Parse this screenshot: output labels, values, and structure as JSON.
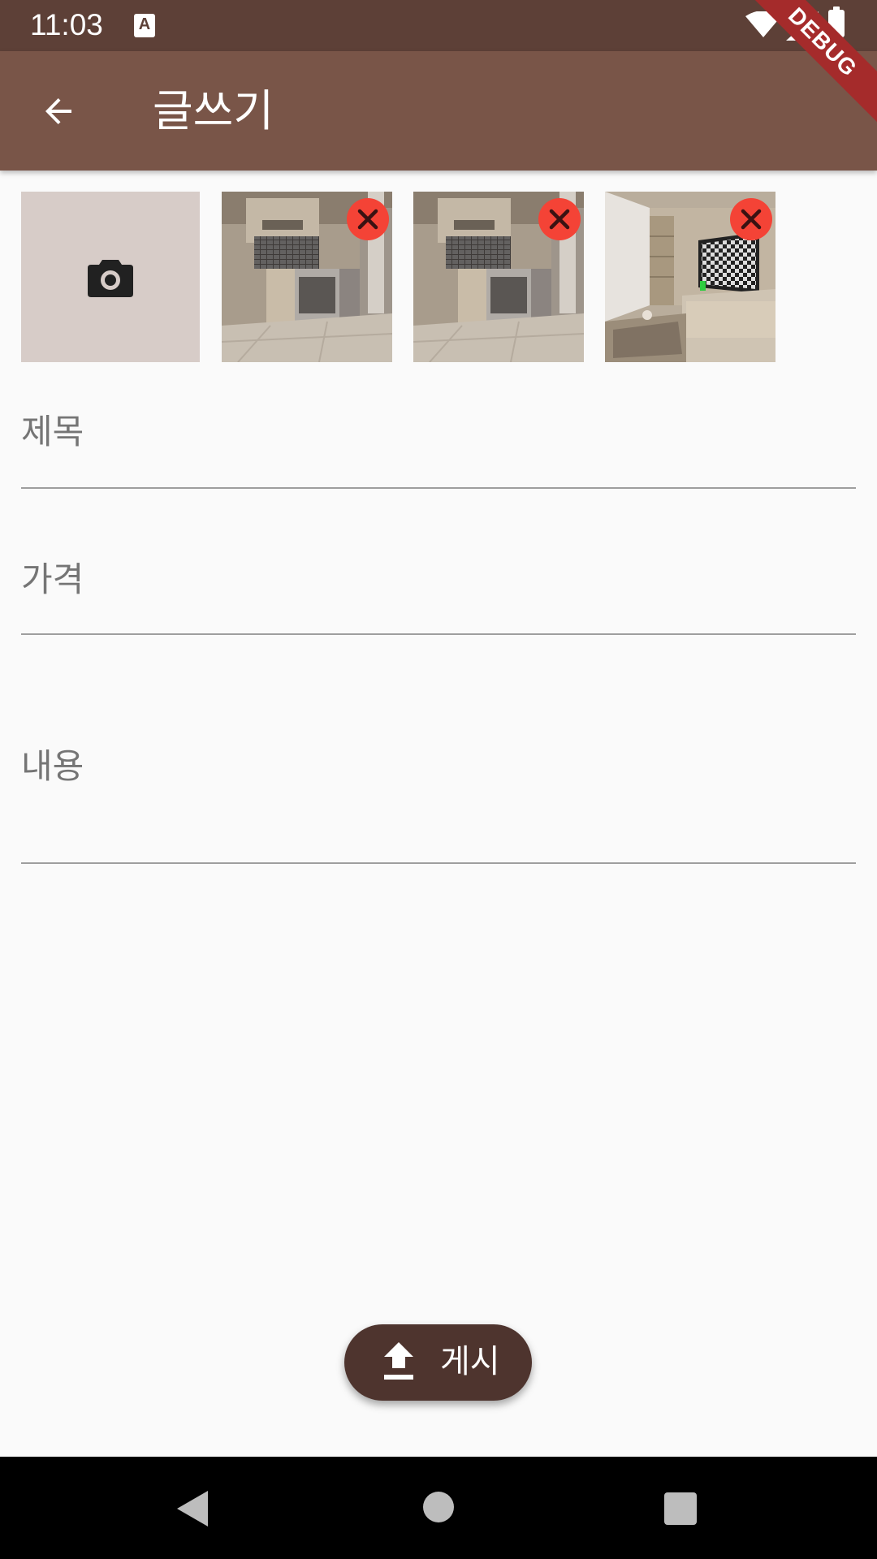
{
  "status_bar": {
    "time": "11:03",
    "notification_icon_letter": "A",
    "icons": [
      "wifi-icon",
      "signal-icon",
      "battery-icon"
    ]
  },
  "app_bar": {
    "title": "글쓰기",
    "back_icon": "arrow-back-icon",
    "background_color": "#795548"
  },
  "debug_banner": "DEBUG",
  "photos": {
    "add_icon": "camera-icon",
    "remove_icon": "close-icon",
    "items": [
      {
        "scene": "kitchen"
      },
      {
        "scene": "kitchen"
      },
      {
        "scene": "living-room-tv"
      }
    ]
  },
  "form": {
    "title_label": "제목",
    "price_label": "가격",
    "content_label": "내용"
  },
  "fab": {
    "label": "게시",
    "icon": "upload-icon",
    "color": "#4e342e"
  },
  "navigation_bar": {
    "icons": [
      "back-triangle-icon",
      "home-circle-icon",
      "recents-square-icon"
    ]
  }
}
